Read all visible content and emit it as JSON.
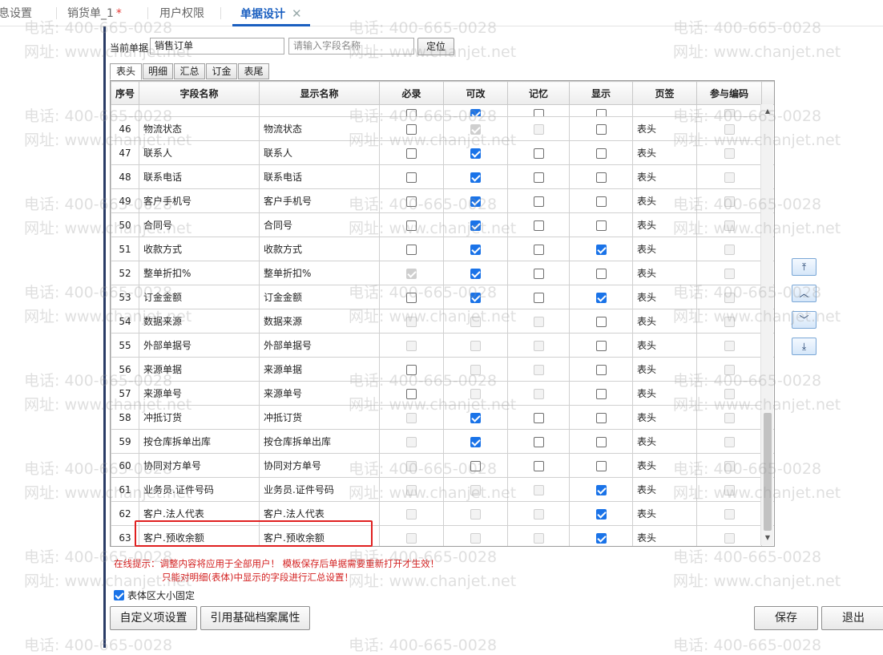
{
  "tabs": [
    {
      "label": "息设置",
      "modified": false,
      "active": false
    },
    {
      "label": "销货单_1",
      "modified": true,
      "active": false
    },
    {
      "label": "用户权限",
      "modified": false,
      "active": false
    },
    {
      "label": "单据设计",
      "modified": false,
      "active": true
    }
  ],
  "modified_marker": "*",
  "close_glyph": "✕",
  "selector": {
    "current_doc_label": "当前单据",
    "current_doc_value": "销售订单",
    "field_search_placeholder": "请输入字段名称",
    "locate_button": "定位"
  },
  "subtabs": [
    "表头",
    "明细",
    "汇总",
    "订金",
    "表尾"
  ],
  "table": {
    "headers": [
      "序号",
      "字段名称",
      "显示名称",
      "必录",
      "可改",
      "记忆",
      "显示",
      "页签",
      "参与编码"
    ],
    "rows": [
      {
        "no": "46",
        "field": "物流状态",
        "display": "物流状态",
        "required": "off",
        "editable": "dison",
        "memory": "dis",
        "show": "off",
        "page": "表头",
        "coding": "dis"
      },
      {
        "no": "47",
        "field": "联系人",
        "display": "联系人",
        "required": "off",
        "editable": "on",
        "memory": "off",
        "show": "off",
        "page": "表头",
        "coding": "dis"
      },
      {
        "no": "48",
        "field": "联系电话",
        "display": "联系电话",
        "required": "off",
        "editable": "on",
        "memory": "off",
        "show": "off",
        "page": "表头",
        "coding": "dis"
      },
      {
        "no": "49",
        "field": "客户手机号",
        "display": "客户手机号",
        "required": "off",
        "editable": "on",
        "memory": "off",
        "show": "off",
        "page": "表头",
        "coding": "dis"
      },
      {
        "no": "50",
        "field": "合同号",
        "display": "合同号",
        "required": "off",
        "editable": "on",
        "memory": "off",
        "show": "off",
        "page": "表头",
        "coding": "dis"
      },
      {
        "no": "51",
        "field": "收款方式",
        "display": "收款方式",
        "required": "off",
        "editable": "on",
        "memory": "off",
        "show": "on",
        "page": "表头",
        "coding": "dis"
      },
      {
        "no": "52",
        "field": "整单折扣%",
        "display": "整单折扣%",
        "required": "dison",
        "editable": "on",
        "memory": "off",
        "show": "off",
        "page": "表头",
        "coding": "dis"
      },
      {
        "no": "53",
        "field": "订金金额",
        "display": "订金金额",
        "required": "off",
        "editable": "on",
        "memory": "off",
        "show": "on",
        "page": "表头",
        "coding": "dis"
      },
      {
        "no": "54",
        "field": "数据来源",
        "display": "数据来源",
        "required": "dis",
        "editable": "dis",
        "memory": "dis",
        "show": "off",
        "page": "表头",
        "coding": "dis"
      },
      {
        "no": "55",
        "field": "外部单据号",
        "display": "外部单据号",
        "required": "dis",
        "editable": "dis",
        "memory": "dis",
        "show": "off",
        "page": "表头",
        "coding": "dis"
      },
      {
        "no": "56",
        "field": "来源单据",
        "display": "来源单据",
        "required": "off",
        "editable": "dis",
        "memory": "dis",
        "show": "off",
        "page": "表头",
        "coding": "dis"
      },
      {
        "no": "57",
        "field": "来源单号",
        "display": "来源单号",
        "required": "off",
        "editable": "dis",
        "memory": "dis",
        "show": "off",
        "page": "表头",
        "coding": "dis"
      },
      {
        "no": "58",
        "field": "冲抵订货",
        "display": "冲抵订货",
        "required": "dis",
        "editable": "on",
        "memory": "off",
        "show": "off",
        "page": "表头",
        "coding": "dis"
      },
      {
        "no": "59",
        "field": "按仓库拆单出库",
        "display": "按仓库拆单出库",
        "required": "dis",
        "editable": "on",
        "memory": "off",
        "show": "off",
        "page": "表头",
        "coding": "dis"
      },
      {
        "no": "60",
        "field": "协同对方单号",
        "display": "协同对方单号",
        "required": "dis",
        "editable": "off",
        "memory": "off",
        "show": "off",
        "page": "表头",
        "coding": "dis"
      },
      {
        "no": "61",
        "field": "业务员.证件号码",
        "display": "业务员.证件号码",
        "required": "dis",
        "editable": "dis",
        "memory": "dis",
        "show": "on",
        "page": "表头",
        "coding": "dis"
      },
      {
        "no": "62",
        "field": "客户.法人代表",
        "display": "客户.法人代表",
        "required": "dis",
        "editable": "dis",
        "memory": "dis",
        "show": "on",
        "page": "表头",
        "coding": "dis"
      },
      {
        "no": "63",
        "field": "客户.预收余额",
        "display": "客户.预收余额",
        "required": "dis",
        "editable": "dis",
        "memory": "dis",
        "show": "on",
        "page": "表头",
        "coding": "dis"
      }
    ]
  },
  "reorder_buttons": [
    {
      "name": "move-top-icon",
      "glyph": "⤒"
    },
    {
      "name": "move-up-icon",
      "glyph": "︿"
    },
    {
      "name": "move-down-icon",
      "glyph": "﹀"
    },
    {
      "name": "move-bottom-icon",
      "glyph": "⤓"
    }
  ],
  "tips": {
    "line1": "在线提示：调整内容将应用于全部用户！ 模板保存后单据需要重新打开才生效！",
    "line2": "只能对明细(表体)中显示的字段进行汇总设置！"
  },
  "fixed_area": {
    "label": "表体区大小固定",
    "checked": true
  },
  "buttons": {
    "custom_items": "自定义项设置",
    "reference_attrs": "引用基础档案属性",
    "save": "保存",
    "exit": "退出"
  },
  "watermark": {
    "phone": "电话: 400-665-0028",
    "site": "网址: www.chanjet.net"
  },
  "colors": {
    "accent": "#1a5fc0",
    "checkbox_on": "#1a73e8",
    "highlight_box": "#e02020",
    "tip_text": "#d32020"
  }
}
